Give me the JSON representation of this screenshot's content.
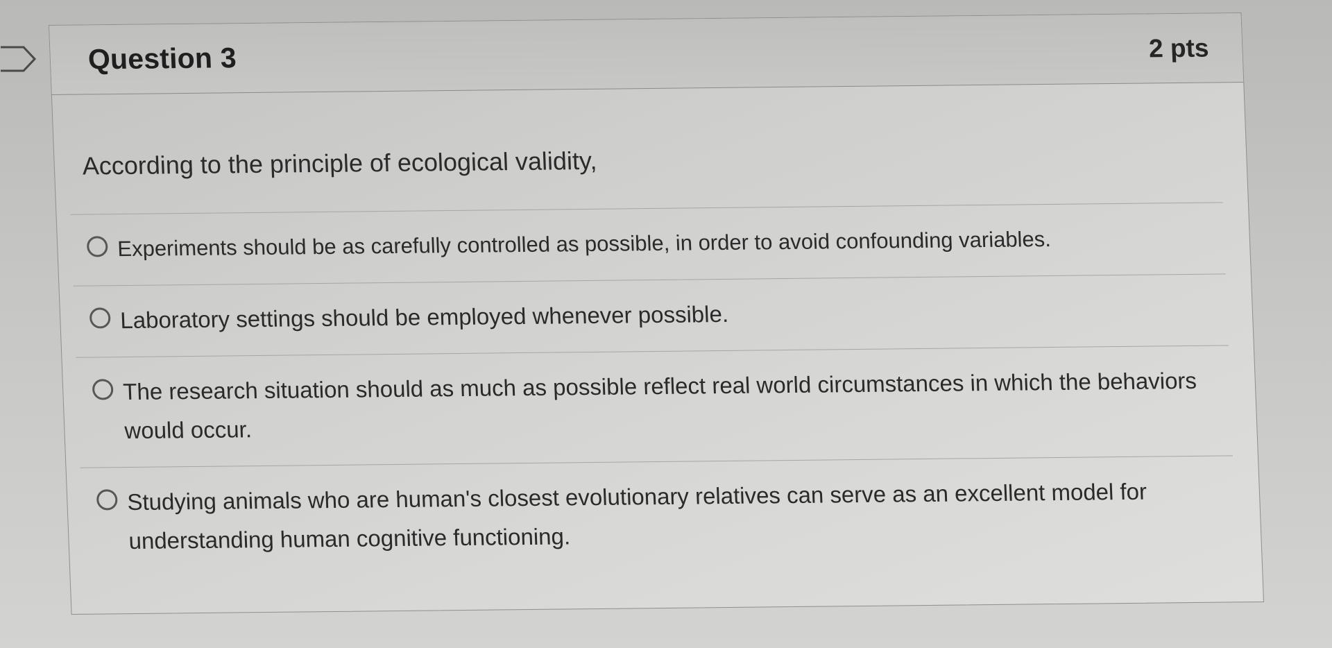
{
  "question": {
    "title": "Question 3",
    "points": "2 pts",
    "prompt": "According to the principle of ecological validity,",
    "answers": [
      {
        "label": "Experiments should be as carefully controlled as possible, in order to avoid confounding variables.",
        "selected": false
      },
      {
        "label": "Laboratory settings should be employed whenever possible.",
        "selected": false
      },
      {
        "label": "The research situation should as much as possible reflect real world circumstances in which the behaviors would occur.",
        "selected": false
      },
      {
        "label": "Studying animals who are human's closest evolutionary relatives can serve as an excellent model for understanding human cognitive functioning.",
        "selected": false
      }
    ]
  },
  "icons": {
    "flag": "flag-outline-icon",
    "radio": "radio-unselected-icon"
  },
  "colors": {
    "header_background": "#c7c7c5",
    "card_background": "#d8d8d6",
    "text": "#2a2a2a",
    "radio_border": "#575757"
  }
}
